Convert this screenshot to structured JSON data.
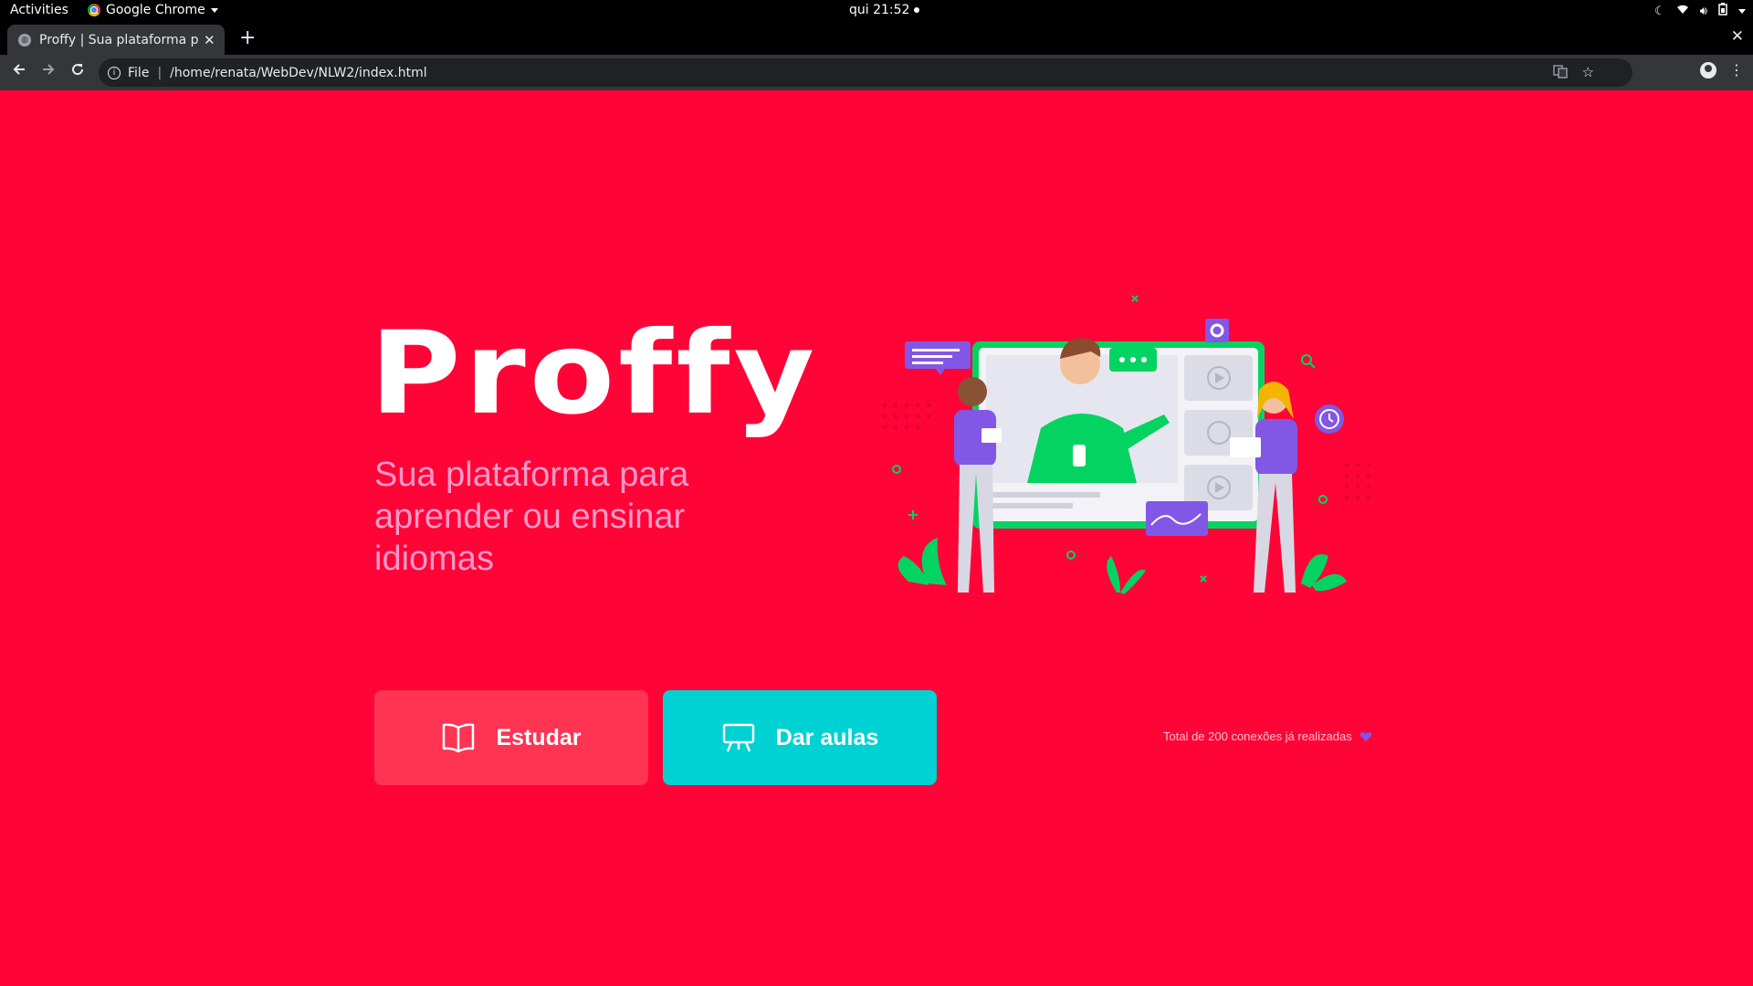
{
  "system": {
    "activities": "Activities",
    "app_name": "Google Chrome",
    "clock": "qui 21:52"
  },
  "browser": {
    "tab_title": "Proffy | Sua plataforma para aprender ou ensinar idiomas",
    "url_scheme_label": "File",
    "url": "/home/renata/WebDev/NLW2/index.html"
  },
  "page": {
    "logo": "Proffy",
    "tagline": "Sua plataforma para aprender ou ensinar idiomas",
    "buttons": {
      "study": "Estudar",
      "teach": "Dar aulas"
    },
    "connections_text": "Total de 200 conexões já realizadas",
    "colors": {
      "background": "#ff0437",
      "study_button": "#ff3352",
      "teach_button": "#00d1d3",
      "tagline": "#ff99c8"
    }
  }
}
